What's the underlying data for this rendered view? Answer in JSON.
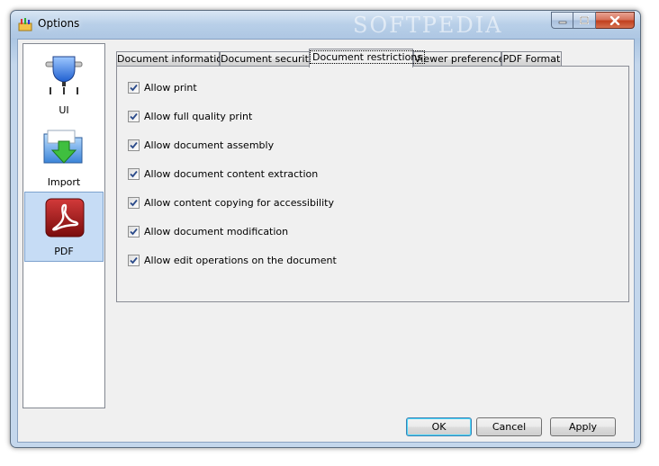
{
  "window": {
    "title": "Options",
    "watermark": "SOFTPEDIA"
  },
  "sidebar": {
    "items": [
      {
        "label": "UI",
        "icon": "ui-plug-icon",
        "selected": false
      },
      {
        "label": "Import",
        "icon": "import-folder-icon",
        "selected": false
      },
      {
        "label": "PDF",
        "icon": "pdf-acrobat-icon",
        "selected": true
      }
    ]
  },
  "tabs": [
    {
      "label": "Document information",
      "active": false
    },
    {
      "label": "Document security",
      "active": false
    },
    {
      "label": "Document restrictions",
      "active": true
    },
    {
      "label": "Viewer preference",
      "active": false
    },
    {
      "label": "PDF Format",
      "active": false
    }
  ],
  "restrictions": [
    {
      "label": "Allow print",
      "checked": true
    },
    {
      "label": "Allow full quality print",
      "checked": true
    },
    {
      "label": "Allow document assembly",
      "checked": true
    },
    {
      "label": "Allow document content extraction",
      "checked": true
    },
    {
      "label": "Allow content copying for accessibility",
      "checked": true
    },
    {
      "label": "Allow document modification",
      "checked": true
    },
    {
      "label": "Allow edit operations on the document",
      "checked": true
    }
  ],
  "buttons": {
    "ok": "OK",
    "cancel": "Cancel",
    "apply": "Apply"
  },
  "colors": {
    "selection": "#c6dcf5",
    "check": "#2a4a8a",
    "close_button": "#c1401f"
  }
}
